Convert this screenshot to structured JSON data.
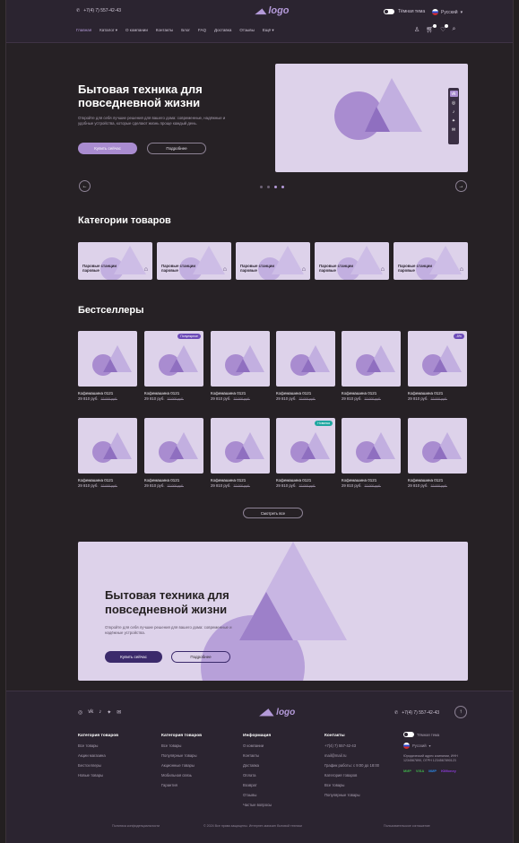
{
  "header": {
    "phone": "+7(4) 7) 557-42-43",
    "logo": "logo",
    "theme_toggle": "Тёмная тема",
    "language": "Русский",
    "nav": [
      "Главная",
      "Каталог",
      "О компании",
      "Контакты",
      "Блог",
      "FAQ",
      "Доставка",
      "Отзывы",
      "Ещё"
    ]
  },
  "hero": {
    "title": "Бытовая техника для повседневной жизни",
    "text": "Откройте для себя лучшие решения для вашего дома: современные, надёжные и удобные устройства, которые сделают жизнь проще каждый день.",
    "primary_button": "Купить сейчас",
    "secondary_button": "Подробнее"
  },
  "categories": {
    "title": "Категории товаров",
    "items": [
      "Паровые станции паровые",
      "Паровые станции паровые",
      "Паровые станции паровые",
      "Паровые станции паровые",
      "Паровые станции паровые"
    ]
  },
  "bestsellers": {
    "title": "Бестселлеры",
    "products": [
      {
        "name": "Кофемашина 0121",
        "price": "29 810 руб.",
        "old": "32 000 руб.",
        "badge": ""
      },
      {
        "name": "Кофемашина 0121",
        "price": "29 810 руб.",
        "old": "32 000 руб.",
        "badge": "Популярное"
      },
      {
        "name": "Кофемашина 0121",
        "price": "29 810 руб.",
        "old": "32 000 руб.",
        "badge": ""
      },
      {
        "name": "Кофемашина 0121",
        "price": "29 810 руб.",
        "old": "32 000 руб.",
        "badge": ""
      },
      {
        "name": "Кофемашина 0121",
        "price": "29 810 руб.",
        "old": "32 000 руб.",
        "badge": ""
      },
      {
        "name": "Кофемашина 0121",
        "price": "29 810 руб.",
        "old": "32 000 руб.",
        "badge": "-5%"
      },
      {
        "name": "Кофемашина 0121",
        "price": "29 810 руб.",
        "old": "32 000 руб.",
        "badge": ""
      },
      {
        "name": "Кофемашина 0121",
        "price": "29 810 руб.",
        "old": "32 000 руб.",
        "badge": ""
      },
      {
        "name": "Кофемашина 0121",
        "price": "29 810 руб.",
        "old": "32 000 руб.",
        "badge": ""
      },
      {
        "name": "Кофемашина 0121",
        "price": "29 810 руб.",
        "old": "32 000 руб.",
        "badge": "Новинка"
      },
      {
        "name": "Кофемашина 0121",
        "price": "29 810 руб.",
        "old": "32 000 руб.",
        "badge": ""
      },
      {
        "name": "Кофемашина 0121",
        "price": "29 810 руб.",
        "old": "32 000 руб.",
        "badge": ""
      }
    ],
    "all_button": "Смотреть все"
  },
  "banner": {
    "title": "Бытовая техника для повседневной жизни",
    "text": "Откройте для себя лучшие решения для вашего дома: современные и надёжные устройства.",
    "primary_button": "Купить сейчас",
    "secondary_button": "Подробнее"
  },
  "footer": {
    "logo": "logo",
    "phone": "+7(4) 7) 557-42-43",
    "columns": [
      {
        "title": "Категория товаров",
        "items": [
          "Все товары",
          "Акции магазина",
          "Бестселлеры",
          "Новые товары"
        ]
      },
      {
        "title": "Категория товаров",
        "items": [
          "Все товары",
          "Популярные товары",
          "Акционные товары",
          "Мобильная связь",
          "Гарантия"
        ]
      },
      {
        "title": "Информация",
        "items": [
          "О компании",
          "Контакты",
          "Доставка",
          "Оплата",
          "Возврат",
          "Отзывы",
          "Частые вопросы"
        ]
      },
      {
        "title": "Контакты",
        "items": [
          "+7(4) 7) 557-42-43",
          "mail@mail.ru",
          "График работы: с 9:00 до 18:00",
          "Категория товаров",
          "Все товары",
          "Популярные товары"
        ]
      }
    ],
    "right": {
      "theme": "Тёмная тема",
      "language": "Русский",
      "address": "Юридический адрес компании, ИНН 1234567890, ОГРН 1234567890123",
      "pay": [
        "МИР",
        "VISA",
        "МИР",
        "ЮMoney"
      ]
    },
    "bottom_left": "Политика конфиденциальности",
    "bottom_center": "© 2024 Все права защищены. Интернет-магазин бытовой техники",
    "bottom_right": "Пользовательское соглашение"
  },
  "colors": {
    "background": "#262125",
    "accent": "#b49ad9",
    "card": "#ddd2ea",
    "dark_button": "#3b2a6b",
    "badge_purple": "#6c4bb8",
    "badge_teal": "#1ea6a0"
  }
}
